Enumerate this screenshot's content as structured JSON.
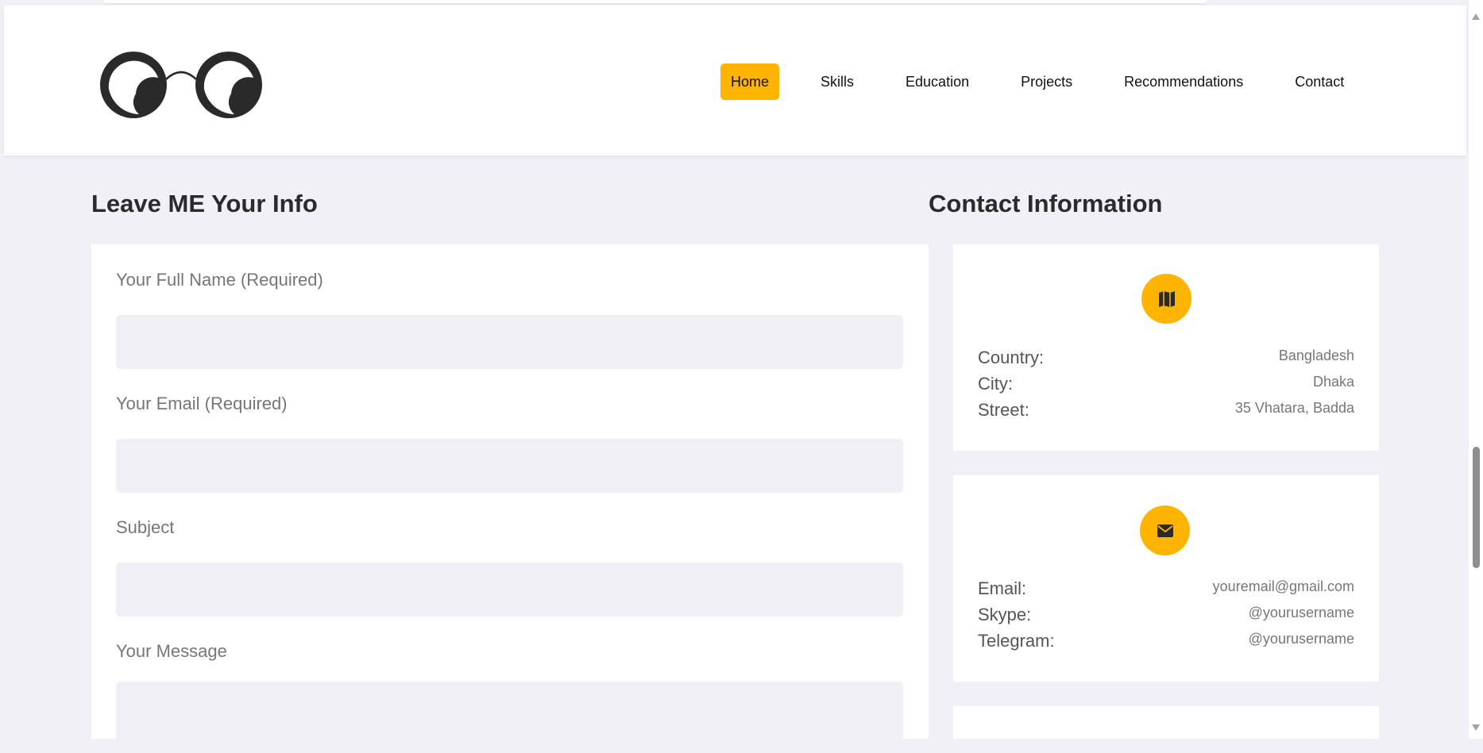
{
  "nav": {
    "items": [
      {
        "label": "Home",
        "active": true
      },
      {
        "label": "Skills",
        "active": false
      },
      {
        "label": "Education",
        "active": false
      },
      {
        "label": "Projects",
        "active": false
      },
      {
        "label": "Recommendations",
        "active": false
      },
      {
        "label": "Contact",
        "active": false
      }
    ]
  },
  "form": {
    "title": "Leave ME Your Info",
    "fields": [
      {
        "label": "Your Full Name (Required)",
        "value": ""
      },
      {
        "label": "Your Email (Required)",
        "value": ""
      },
      {
        "label": "Subject",
        "value": ""
      },
      {
        "label": "Your Message",
        "value": ""
      }
    ]
  },
  "contact": {
    "title": "Contact Information",
    "cards": [
      {
        "icon": "map-icon",
        "rows": [
          {
            "key": "Country:",
            "value": "Bangladesh"
          },
          {
            "key": "City:",
            "value": "Dhaka"
          },
          {
            "key": "Street:",
            "value": "35 Vhatara, Badda"
          }
        ]
      },
      {
        "icon": "envelope-icon",
        "rows": [
          {
            "key": "Email:",
            "value": "youremail@gmail.com"
          },
          {
            "key": "Skype:",
            "value": "@yourusername"
          },
          {
            "key": "Telegram:",
            "value": "@yourusername"
          }
        ]
      }
    ]
  },
  "colors": {
    "accent": "#ffb400",
    "page_background": "#f0f0f6",
    "input_background": "#efeff5",
    "heading": "#2b2b2b"
  }
}
